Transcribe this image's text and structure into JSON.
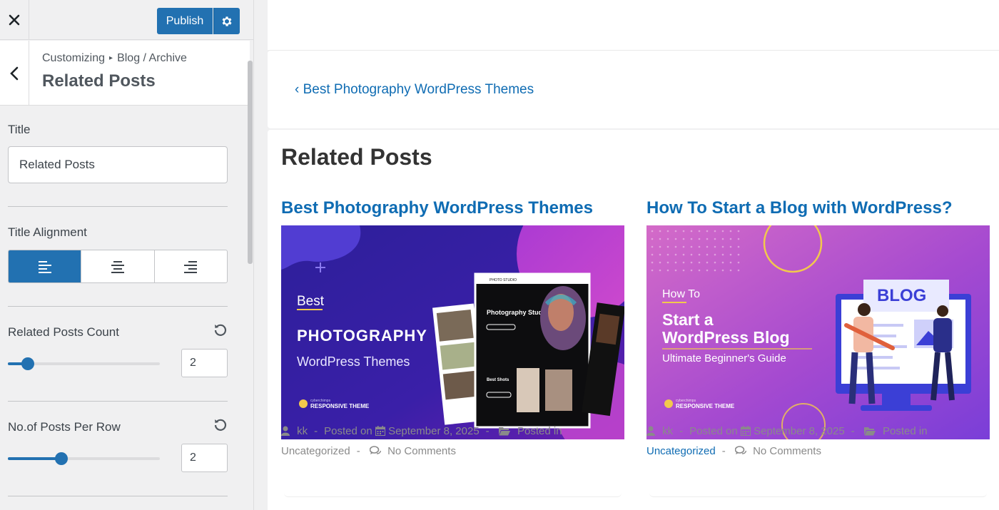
{
  "topbar": {
    "publish_label": "Publish"
  },
  "section": {
    "breadcrumb_root": "Customizing",
    "breadcrumb_sep": "▸",
    "breadcrumb_leaf": "Blog / Archive",
    "title": "Related Posts"
  },
  "controls": {
    "title_label": "Title",
    "title_value": "Related Posts",
    "alignment_label": "Title Alignment",
    "alignment_options": [
      "left",
      "center",
      "right"
    ],
    "alignment_selected": "left",
    "count_label": "Related Posts Count",
    "count_value": "2",
    "count_slider_fraction": 0.13,
    "per_row_label": "No.of Posts Per Row",
    "per_row_value": "2",
    "per_row_slider_fraction": 0.35
  },
  "preview": {
    "prev_link": "‹ Best Photography WordPress Themes",
    "heading": "Related Posts",
    "posts": [
      {
        "title": "Best Photography WordPress Themes",
        "image": {
          "line1": "Best",
          "line2": "PHOTOGRAPHY",
          "line3": "WordPress Themes",
          "brand_small": "cyberchimps",
          "brand": "RESPONSIVE THEME",
          "mock_title": "Photography Studio",
          "mock_sub": "Best Shots",
          "mock_logo": "PHOTO STUDIO"
        },
        "author": "kk",
        "posted_on": "Posted on",
        "date": "September 8, 2025",
        "posted_in": "Posted in",
        "category": "Uncategorized",
        "comments": "No Comments"
      },
      {
        "title": "How To Start a Blog with WordPress?",
        "image": {
          "line1": "How To",
          "line2": "Start a",
          "line3": "WordPress Blog",
          "line4": "Ultimate Beginner's Guide",
          "badge": "BLOG",
          "brand_small": "cyberchimps",
          "brand": "RESPONSIVE THEME"
        },
        "author": "kk",
        "posted_on": "Posted on",
        "date": "September 8, 2025",
        "posted_in": "Posted in",
        "category": "Uncategorized",
        "comments": "No Comments"
      }
    ]
  },
  "colors": {
    "accent": "#2271b1",
    "link": "#0f6cb3"
  }
}
